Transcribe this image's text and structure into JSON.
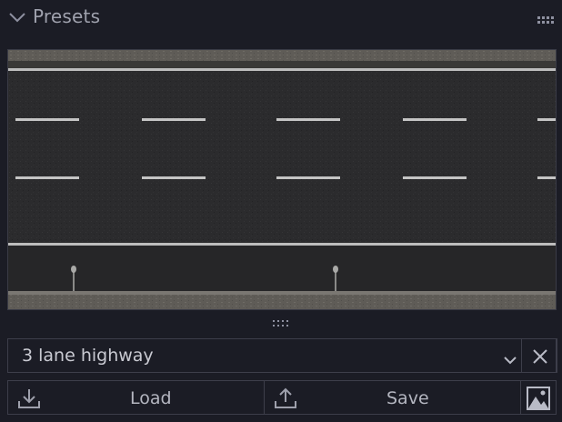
{
  "header": {
    "title": "Presets",
    "collapse_icon": "chevron-down-icon",
    "menu_icon": "drag-handle-icon"
  },
  "preview": {
    "description_icon": "road-preview-image",
    "asphalt_color": "#2b2b2d",
    "curb_color": "#6f6c66",
    "marking_color": "#c4c4c4"
  },
  "preset_select": {
    "value": "3 lane highway",
    "caret_icon": "chevron-down-icon",
    "clear_icon": "close-icon"
  },
  "actions": {
    "load_label": "Load",
    "load_icon": "download-icon",
    "save_label": "Save",
    "save_icon": "upload-icon",
    "thumbnail_icon": "image-icon"
  }
}
